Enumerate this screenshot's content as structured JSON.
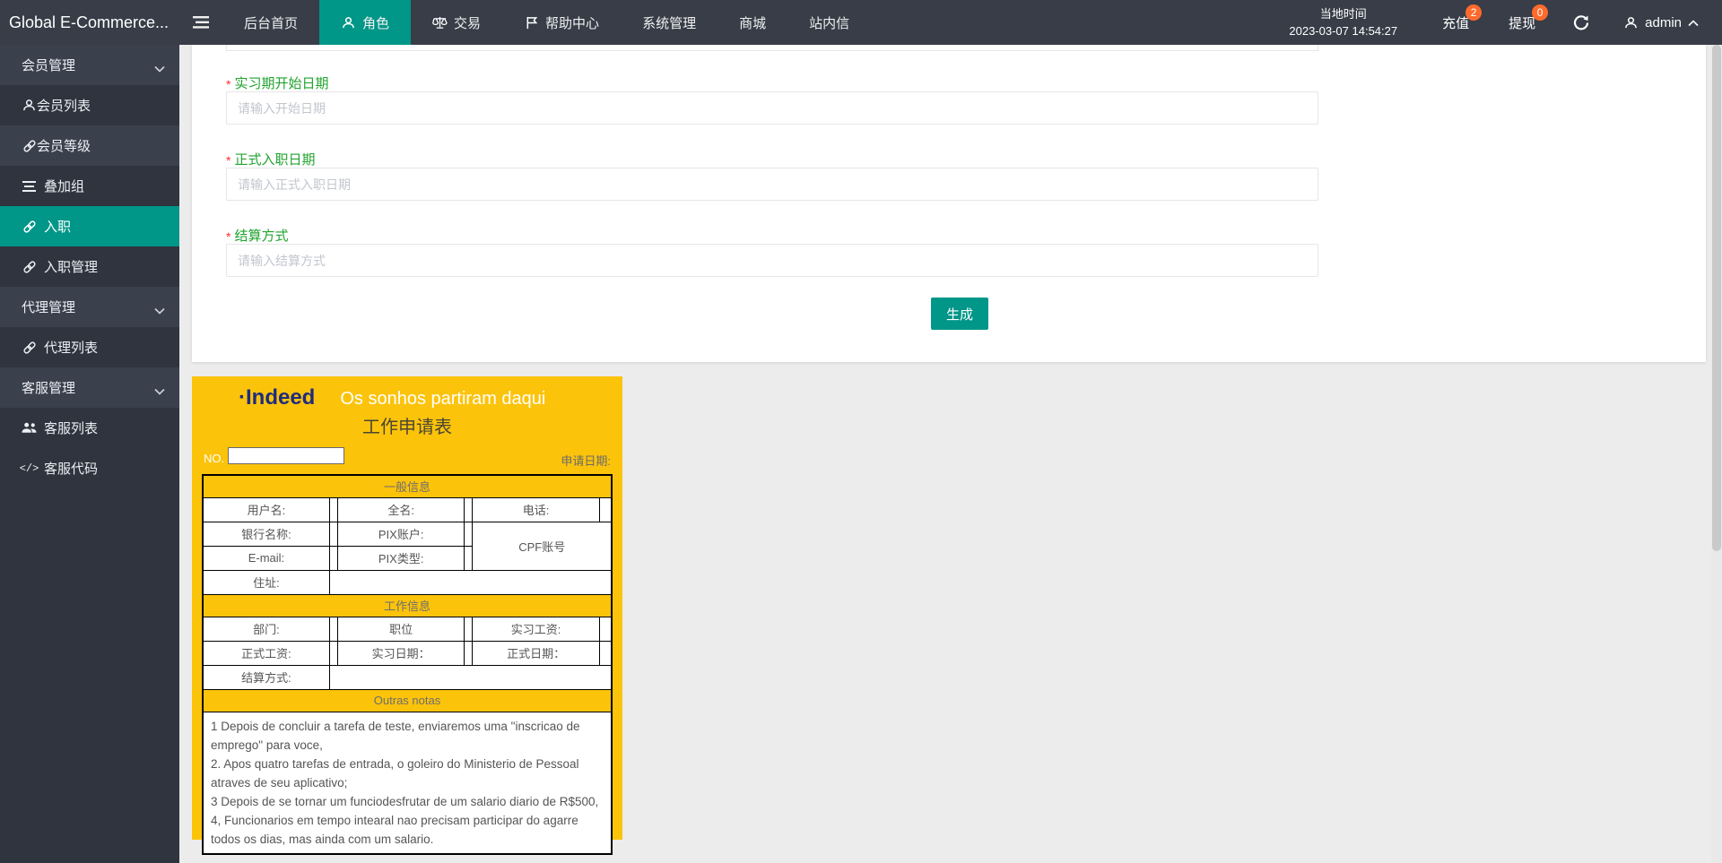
{
  "navbar": {
    "logo": "Global E-Commerce...",
    "menu": [
      {
        "label": "后台首页",
        "icon": null
      },
      {
        "label": "角色",
        "icon": "user",
        "active": true
      },
      {
        "label": "交易",
        "icon": "scales"
      },
      {
        "label": "帮助中心",
        "icon": "flag"
      },
      {
        "label": "系统管理",
        "icon": null
      },
      {
        "label": "商城",
        "icon": null
      },
      {
        "label": "站内信",
        "icon": null
      }
    ],
    "time_label": "当地时间",
    "time_value": "2023-03-07 14:54:27",
    "recharge_label": "充值",
    "recharge_badge": "2",
    "withdraw_label": "提现",
    "withdraw_badge": "0",
    "username": "admin"
  },
  "sidebar": {
    "items": [
      {
        "label": "会员管理",
        "type": "group"
      },
      {
        "label": "会员列表",
        "type": "child",
        "icon": "user"
      },
      {
        "label": "会员等级",
        "type": "group-like",
        "icon": "link"
      },
      {
        "label": "叠加组",
        "type": "child",
        "icon": "list"
      },
      {
        "label": "入职",
        "type": "active",
        "icon": "link"
      },
      {
        "label": "入职管理",
        "type": "child",
        "icon": "link"
      },
      {
        "label": "代理管理",
        "type": "group"
      },
      {
        "label": "代理列表",
        "type": "child",
        "icon": "link"
      },
      {
        "label": "客服管理",
        "type": "group"
      },
      {
        "label": "客服列表",
        "type": "child",
        "icon": "users"
      },
      {
        "label": "客服代码",
        "type": "child",
        "icon": "code"
      }
    ]
  },
  "form": {
    "fields": [
      {
        "label": "实习期开始日期",
        "placeholder": "请输入开始日期"
      },
      {
        "label": "正式入职日期",
        "placeholder": "请输入正式入职日期"
      },
      {
        "label": "结算方式",
        "placeholder": "请输入结算方式"
      }
    ],
    "submit_label": "生成"
  },
  "application_form": {
    "brand": "·Indeed",
    "slogan": "Os sonhos partiram daqui",
    "title": "工作申请表",
    "no_label": "NO.",
    "no_value": "",
    "apply_date_label": "申请日期:",
    "general": {
      "header": "一般信息",
      "r1c1": "用户名:",
      "r1c2": "全名:",
      "r1c3": "电话:",
      "r2c1": "银行名称:",
      "r2c2": "PIX账户:",
      "r2c3": "CPF账号",
      "r3c1": "E-mail:",
      "r3c2": "PIX类型:",
      "r4c1": "住址:"
    },
    "work": {
      "header": "工作信息",
      "r1c1": "部门:",
      "r1c2": "职位",
      "r1c3": "实习工资:",
      "r2c1": "正式工资:",
      "r2c2": "实习日期：",
      "r2c3": "正式日期：",
      "r3c1": "结算方式:"
    },
    "notes": {
      "header": "Outras notas",
      "lines": [
        "1 Depois de concluir a tarefa de teste, enviaremos uma \"inscricao de emprego\" para voce,",
        "2. Apos quatro tarefas de entrada, o goleiro do Ministerio de Pessoal atraves de seu aplicativo;",
        "3 Depois de se tornar um funciodesfrutar de um salario diario de R$500,",
        "4, Funcionarios em tempo intearal nao precisam participar do agarre todos os dias, mas ainda com um salario."
      ]
    }
  },
  "colors": {
    "accent_teal": "#009688",
    "navbar_bg": "#383d48",
    "badge_orange": "#ff6a2c",
    "label_green": "#21a32f",
    "form_yellow": "#fcc30b",
    "brand_navy": "#1f2d7c"
  }
}
